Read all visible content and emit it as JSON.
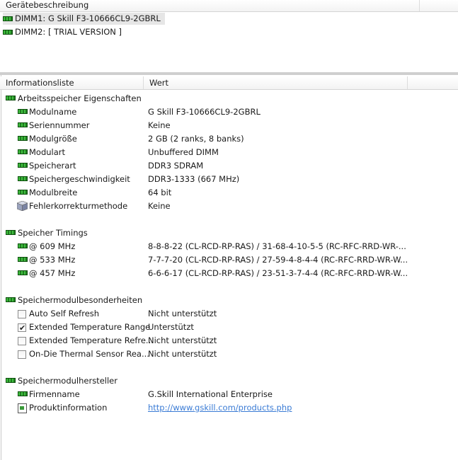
{
  "top_header": {
    "title": "Gerätebeschreibung"
  },
  "devices": [
    {
      "label": "DIMM1: G Skill F3-10666CL9-2GBRL",
      "icon": "memory-module-icon",
      "selected": true
    },
    {
      "label": "DIMM2: [ TRIAL VERSION ]",
      "icon": "memory-module-icon",
      "selected": false
    }
  ],
  "info_header": {
    "col1": "Informationsliste",
    "col2": "Wert"
  },
  "sections": [
    {
      "title": "Arbeitsspeicher Eigenschaften",
      "rows": [
        {
          "name": "Modulname",
          "value": "G Skill F3-10666CL9-2GBRL",
          "icon": "memory-module-icon"
        },
        {
          "name": "Seriennummer",
          "value": "Keine",
          "icon": "memory-module-icon"
        },
        {
          "name": "Modulgröße",
          "value": "2 GB (2 ranks, 8 banks)",
          "icon": "memory-module-icon"
        },
        {
          "name": "Modulart",
          "value": "Unbuffered DIMM",
          "icon": "memory-module-icon"
        },
        {
          "name": "Speicherart",
          "value": "DDR3 SDRAM",
          "icon": "memory-module-icon"
        },
        {
          "name": "Speichergeschwindigkeit",
          "value": "DDR3-1333 (667 MHz)",
          "icon": "memory-module-icon"
        },
        {
          "name": "Modulbreite",
          "value": "64 bit",
          "icon": "memory-module-icon"
        },
        {
          "name": "Fehlerkorrekturmethode",
          "value": "Keine",
          "icon": "ecc-cube-icon"
        }
      ]
    },
    {
      "title": "Speicher Timings",
      "rows": [
        {
          "name": "@ 609 MHz",
          "value": "8-8-8-22  (CL-RCD-RP-RAS) / 31-68-4-10-5-5  (RC-RFC-RRD-WR-...",
          "icon": "memory-module-icon"
        },
        {
          "name": "@ 533 MHz",
          "value": "7-7-7-20  (CL-RCD-RP-RAS) / 27-59-4-8-4-4  (RC-RFC-RRD-WR-W...",
          "icon": "memory-module-icon"
        },
        {
          "name": "@ 457 MHz",
          "value": "6-6-6-17  (CL-RCD-RP-RAS) / 23-51-3-7-4-4  (RC-RFC-RRD-WR-W...",
          "icon": "memory-module-icon"
        }
      ]
    },
    {
      "title": "Speichermodulbesonderheiten",
      "rows": [
        {
          "name": "Auto Self Refresh",
          "value": "Nicht unterstützt",
          "icon": "checkbox-icon",
          "checked": false
        },
        {
          "name": "Extended Temperature Range",
          "value": "Unterstützt",
          "icon": "checkbox-icon",
          "checked": true
        },
        {
          "name": "Extended Temperature Refre...",
          "value": "Nicht unterstützt",
          "icon": "checkbox-icon",
          "checked": false
        },
        {
          "name": "On-Die Thermal Sensor Rea...",
          "value": "Nicht unterstützt",
          "icon": "checkbox-icon",
          "checked": false
        }
      ]
    },
    {
      "title": "Speichermodulhersteller",
      "rows": [
        {
          "name": "Firmenname",
          "value": "G.Skill International Enterprise",
          "icon": "memory-module-icon"
        },
        {
          "name": "Produktinformation",
          "value": "http://www.gskill.com/products.php",
          "icon": "document-link-icon",
          "link": true
        }
      ]
    }
  ],
  "colors": {
    "link": "#3a7bd5",
    "selection": "#e6e6e6",
    "module_green": "#1f7a1f"
  }
}
